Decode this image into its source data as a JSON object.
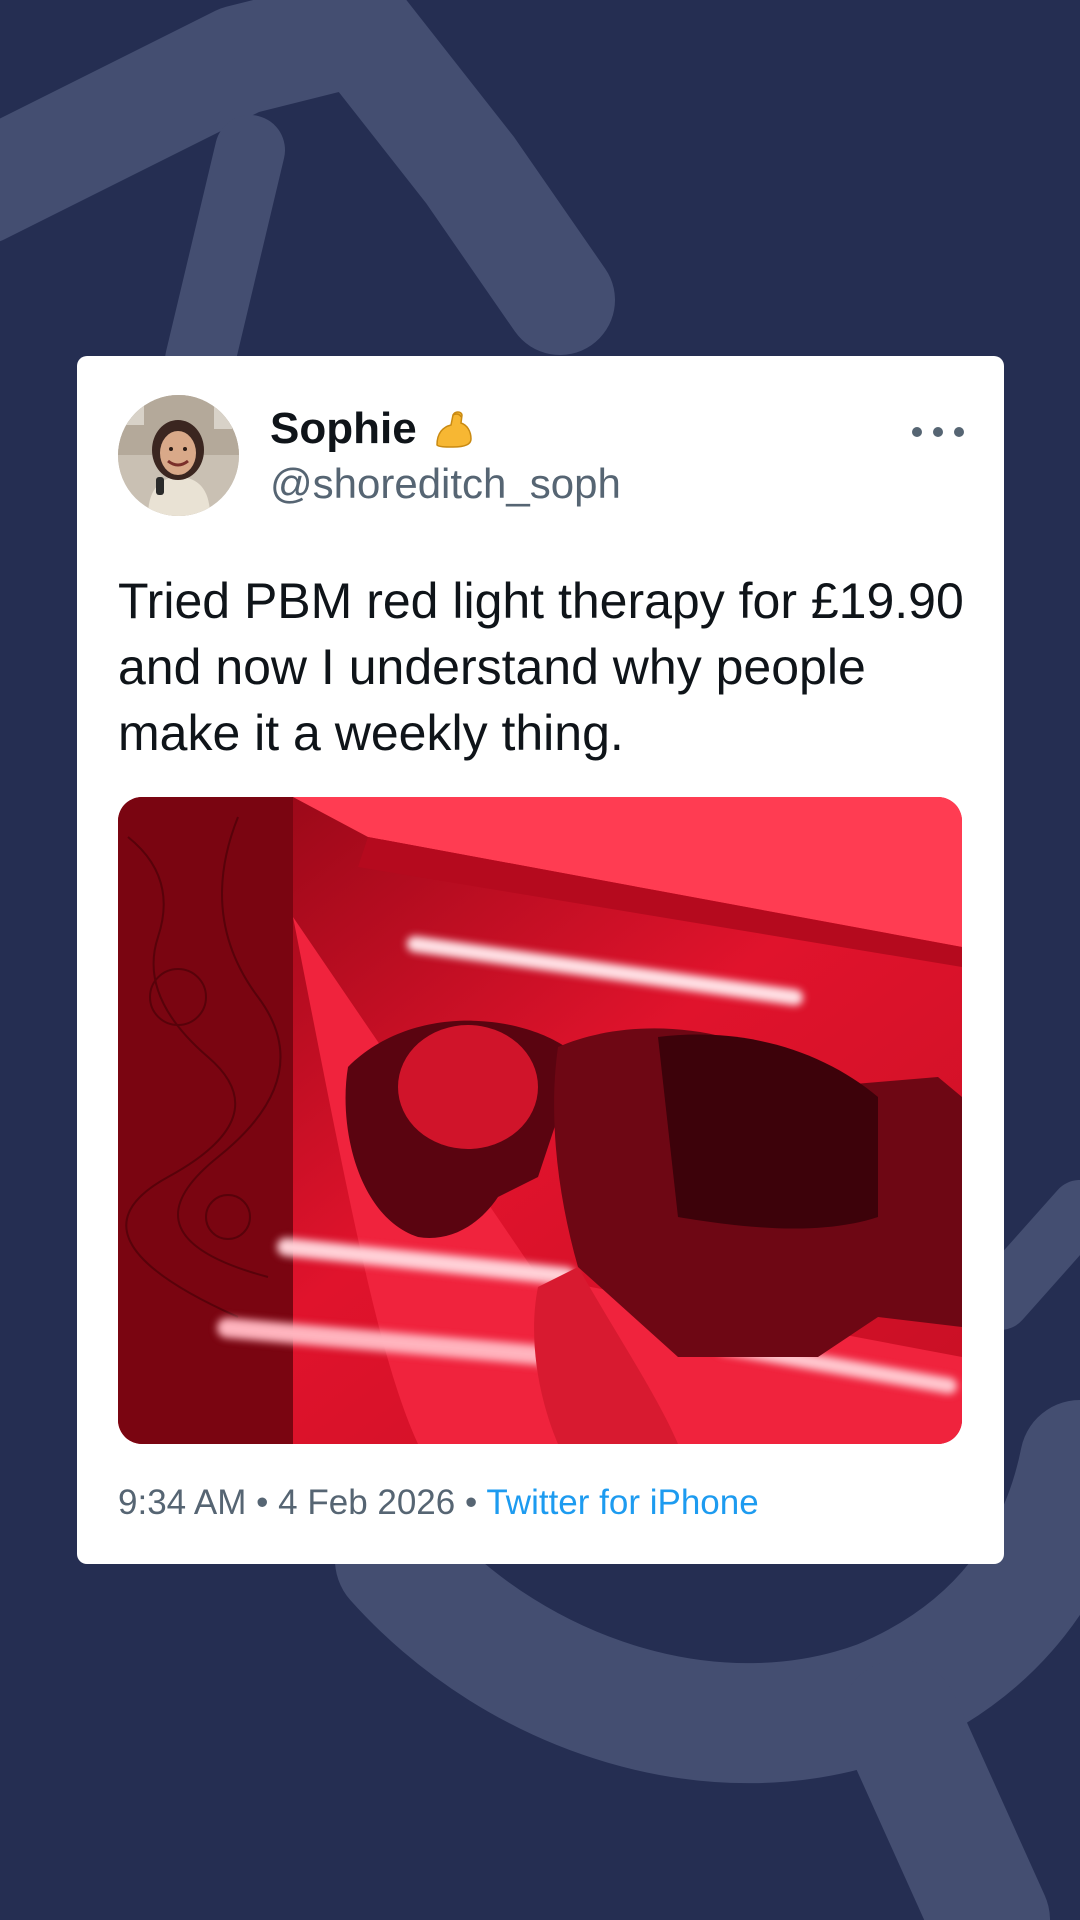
{
  "colors": {
    "background": "#252e52",
    "card": "#ffffff",
    "secondary_text": "#566573",
    "link": "#1d9bf0"
  },
  "tweet": {
    "author_name": "Sophie",
    "author_badge_icon": "flexed-biceps-emoji",
    "handle": "@shoreditch_soph",
    "text": "Tried PBM red light therapy for £19.90 and now I understand why people make it a weekly thing.",
    "time": "9:34 AM",
    "separator": "•",
    "date": "4 Feb 2026",
    "source": "Twitter for iPhone",
    "more_icon": "more-horizontal-icon",
    "media_description_icon": "photo"
  }
}
